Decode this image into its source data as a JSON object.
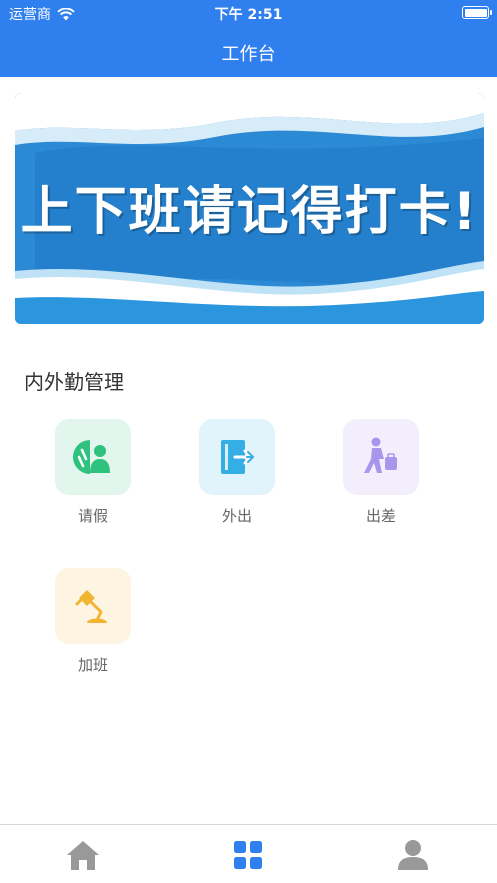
{
  "status_bar": {
    "carrier": "运营商",
    "time": "下午 2:51"
  },
  "nav": {
    "title": "工作台"
  },
  "banner": {
    "text": "上下班请记得打卡!"
  },
  "section": {
    "title": "内外勤管理",
    "items": [
      {
        "label": "请假",
        "icon": "leave-icon",
        "bg": "#e2f6ee",
        "color": "#2ec27e"
      },
      {
        "label": "外出",
        "icon": "go-out-icon",
        "bg": "#e1f3fb",
        "color": "#35aee6"
      },
      {
        "label": "出差",
        "icon": "business-trip-icon",
        "bg": "#f2eefc",
        "color": "#a996ec"
      },
      {
        "label": "加班",
        "icon": "overtime-icon",
        "bg": "#fdf4e2",
        "color": "#f2b533"
      }
    ]
  },
  "tabbar": {
    "tabs": [
      {
        "icon": "home-icon",
        "active": false
      },
      {
        "icon": "grid-icon",
        "active": true
      },
      {
        "icon": "user-icon",
        "active": false
      }
    ]
  },
  "colors": {
    "primary": "#2f7fee",
    "inactive": "#999999"
  }
}
